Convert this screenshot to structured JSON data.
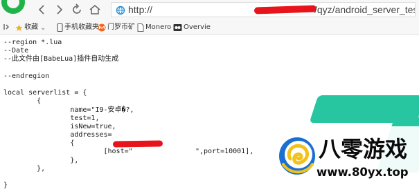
{
  "browser": {
    "address_bar": {
      "scheme": "http://",
      "path": "/qyz/android_server_test.txt"
    }
  },
  "bookmarks": [
    {
      "label": "收藏",
      "icon": "star-icon"
    },
    {
      "label": "手机收藏夹",
      "icon": "phone-icon"
    },
    {
      "label": "门罗币矿",
      "icon": "monero-icon"
    },
    {
      "label": "Monero",
      "icon": "page-icon"
    },
    {
      "label": "Overvie",
      "icon": "overview-icon"
    }
  ],
  "file_lines": [
    "--region *.lua",
    "--Date",
    "--此文件由[BabeLua]插件自动生成",
    "",
    "--endregion",
    "",
    "local serverlist = {",
    "        {",
    "                name=\"I9-安卓�?,",
    "                test=1,",
    "                isNew=true,",
    "                addresses=",
    "                {",
    "                        [host=\"               \",port=10001],",
    "                },",
    "        },",
    "",
    "}"
  ],
  "watermark": {
    "title": "八零游戏",
    "url": "www.80yx.top"
  },
  "colors": {
    "redaction": "#e8141c",
    "brand_teal": "#27c5a0",
    "logo_blue": "#1a6fd1"
  }
}
